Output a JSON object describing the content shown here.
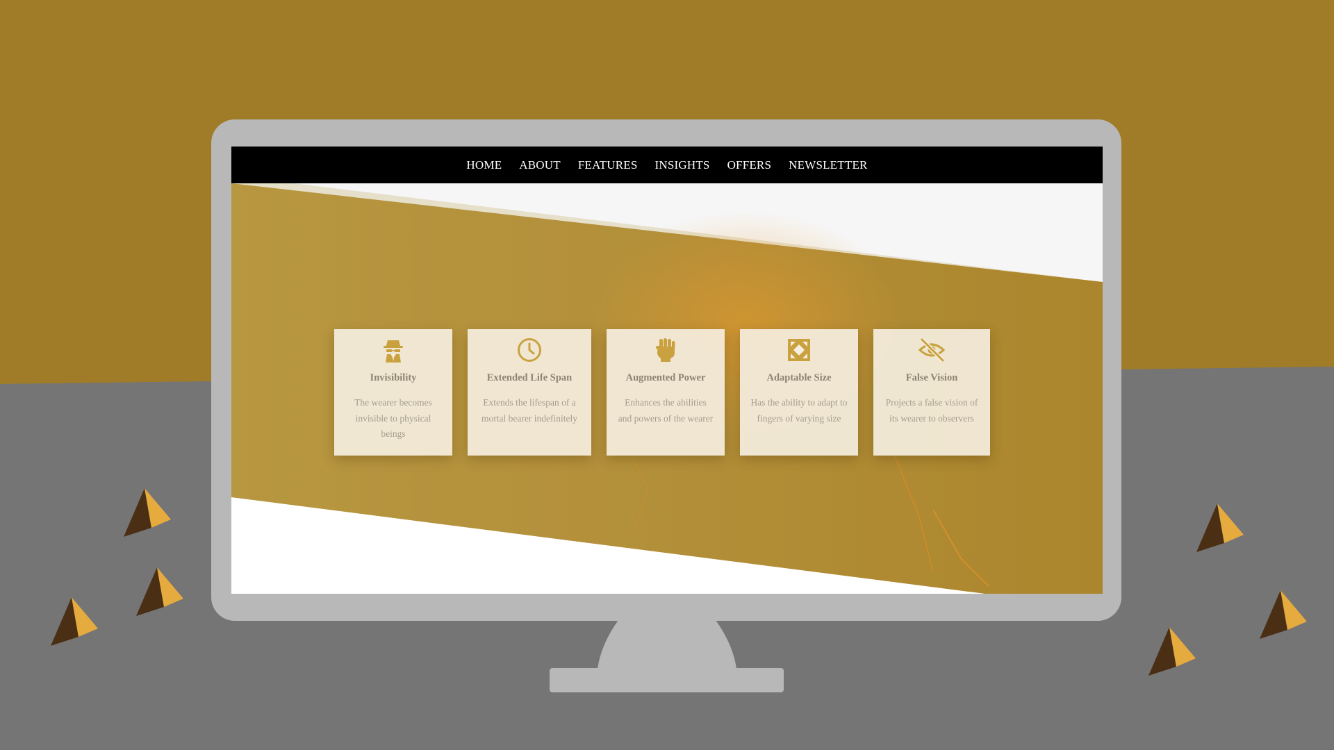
{
  "nav": {
    "items": [
      {
        "label": "HOME"
      },
      {
        "label": "ABOUT"
      },
      {
        "label": "FEATURES"
      },
      {
        "label": "INSIGHTS"
      },
      {
        "label": "OFFERS"
      },
      {
        "label": "NEWSLETTER"
      }
    ]
  },
  "features": [
    {
      "icon": "spy-icon",
      "title": "Invisibility",
      "desc": "The wearer becomes invisible to physical beings"
    },
    {
      "icon": "clock-icon",
      "title": "Extended Life Span",
      "desc": "Extends the lifespan of a mortal bearer indefinitely"
    },
    {
      "icon": "fist-icon",
      "title": "Augmented Power",
      "desc": "Enhances the abilities and powers of the wearer"
    },
    {
      "icon": "expand-arrows-icon",
      "title": "Adaptable Size",
      "desc": "Has the ability to adapt to fingers of varying size"
    },
    {
      "icon": "eye-slash-icon",
      "title": "False Vision",
      "desc": "Projects a false vision of its wearer to observers"
    }
  ],
  "colors": {
    "gold_background": "#a17c28",
    "gray_background": "#757575",
    "monitor_bezel": "#b8b8b8",
    "navbar": "#000000",
    "icon_gold": "#c9a23f",
    "card_background": "#f6efe2",
    "pyramid_dark": "#4a2f14",
    "pyramid_light": "#e6ab3e"
  }
}
